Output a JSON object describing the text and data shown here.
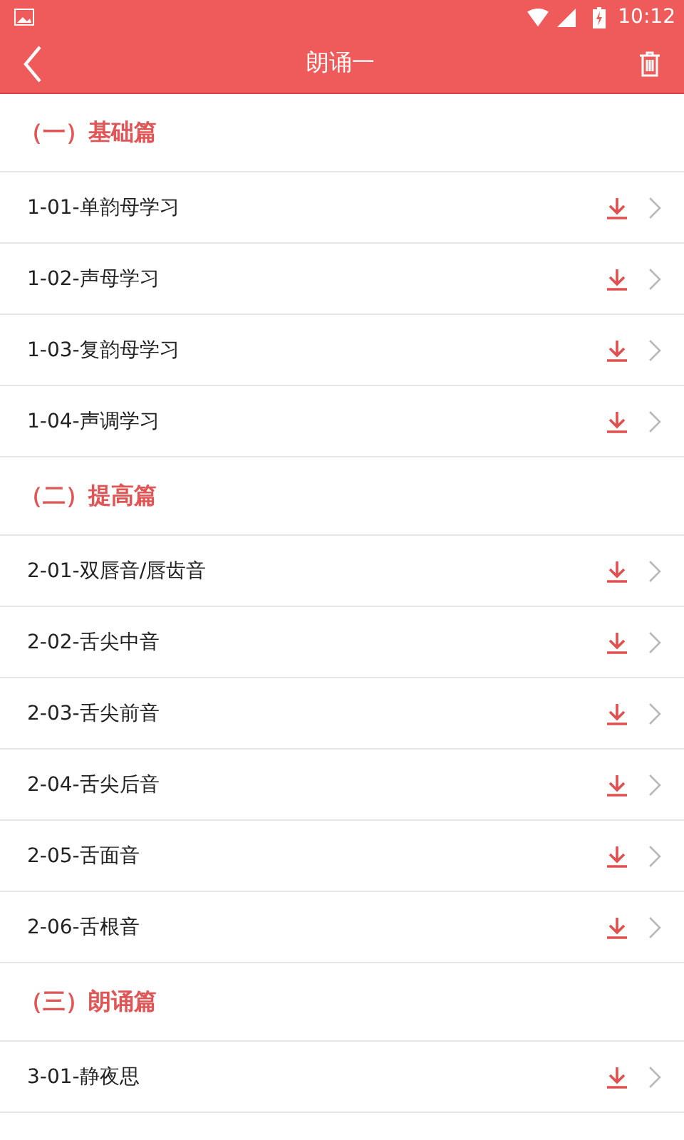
{
  "status_bar": {
    "time": "10:12"
  },
  "toolbar": {
    "title": "朗诵一"
  },
  "sections": [
    {
      "title": "（一）基础篇",
      "items": [
        {
          "title": "1-01-单韵母学习"
        },
        {
          "title": "1-02-声母学习"
        },
        {
          "title": "1-03-复韵母学习"
        },
        {
          "title": "1-04-声调学习"
        }
      ]
    },
    {
      "title": "（二）提高篇",
      "items": [
        {
          "title": "2-01-双唇音/唇齿音"
        },
        {
          "title": "2-02-舌尖中音"
        },
        {
          "title": "2-03-舌尖前音"
        },
        {
          "title": "2-04-舌尖后音"
        },
        {
          "title": "2-05-舌面音"
        },
        {
          "title": "2-06-舌根音"
        }
      ]
    },
    {
      "title": "（三）朗诵篇",
      "items": [
        {
          "title": "3-01-静夜思"
        }
      ]
    }
  ]
}
